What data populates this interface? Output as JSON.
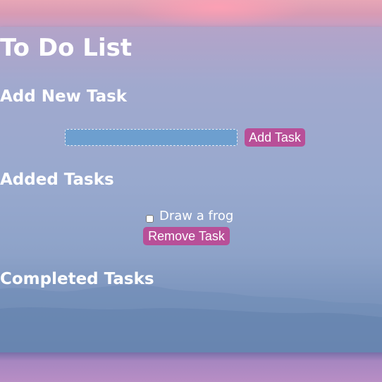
{
  "app": {
    "title": "To Do List"
  },
  "add_section": {
    "heading": "Add New Task",
    "input_value": "",
    "add_button_label": "Add Task"
  },
  "added_section": {
    "heading": "Added Tasks",
    "tasks": [
      {
        "text": "Draw a frog",
        "checked": false,
        "remove_label": "Remove Task"
      }
    ]
  },
  "completed_section": {
    "heading": "Completed Tasks"
  },
  "colors": {
    "button": "#b84f98",
    "input": "#6d9fcf",
    "text": "#ffffff"
  }
}
